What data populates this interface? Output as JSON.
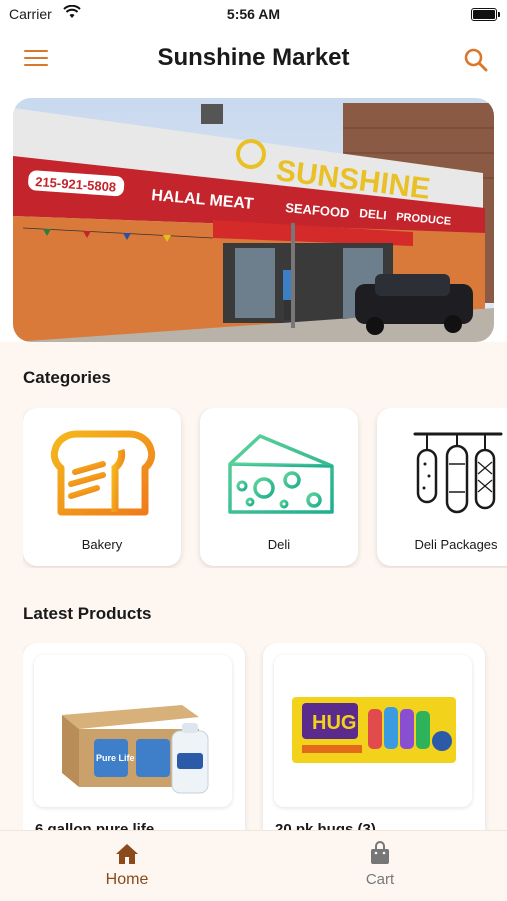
{
  "status_bar": {
    "carrier": "Carrier",
    "time": "5:56 AM"
  },
  "header": {
    "title": "Sunshine Market",
    "menu_icon": "hamburger-menu-icon",
    "search_icon": "search-icon"
  },
  "hero": {
    "store_name": "SUNSHINE",
    "phone": "215-921-5808",
    "sign_items": [
      "HALAL MEAT",
      "SEAFOOD",
      "DELI",
      "PRODUCE"
    ]
  },
  "categories": {
    "title": "Categories",
    "items": [
      {
        "label": "Bakery",
        "icon": "bread-icon"
      },
      {
        "label": "Deli",
        "icon": "cheese-icon"
      },
      {
        "label": "Deli Packages",
        "icon": "sausages-icon"
      }
    ]
  },
  "latest_products": {
    "title": "Latest Products",
    "items": [
      {
        "name": "6 gallon pure life",
        "image_text": "Pure Life"
      },
      {
        "name": "20 pk hugs (3)",
        "image_text": "HUG"
      }
    ]
  },
  "tabbar": {
    "items": [
      {
        "label": "Home",
        "icon": "home-icon",
        "active": true
      },
      {
        "label": "Cart",
        "icon": "shopping-bag-icon",
        "active": false
      }
    ]
  },
  "colors": {
    "accent": "#d9772c",
    "active_tab": "#8b4a1c",
    "inactive_tab": "#777777",
    "background": "#fdf6f1"
  }
}
